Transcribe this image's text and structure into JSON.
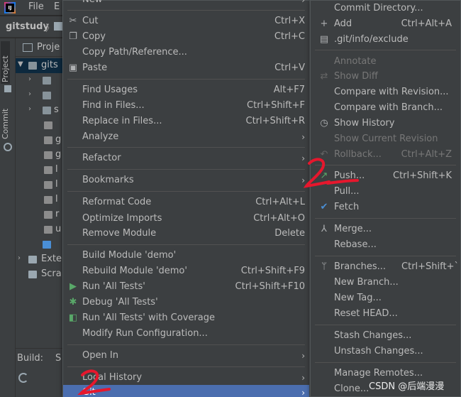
{
  "menubar": {
    "logo_text": "IJ",
    "items": [
      "File",
      "E"
    ]
  },
  "navbar": {
    "project": "gitstudy"
  },
  "left_strip": {
    "project_tab": "Project",
    "commit_tab": "Commit"
  },
  "project_panel": {
    "title": "Proje",
    "rows": [
      "gits",
      "",
      "",
      "s",
      "",
      "g",
      "g",
      "l",
      "l",
      "l",
      "r",
      "u",
      "",
      "Exte",
      "Scra"
    ]
  },
  "build_panel": {
    "label": "Build:",
    "tab": "S"
  },
  "left_menu": {
    "new": "New",
    "cut": "Cut",
    "cut_sc": "Ctrl+X",
    "copy": "Copy",
    "copy_sc": "Ctrl+C",
    "copy_path": "Copy Path/Reference...",
    "paste": "Paste",
    "paste_sc": "Ctrl+V",
    "find_usages": "Find Usages",
    "find_usages_sc": "Alt+F7",
    "find_in_files": "Find in Files...",
    "find_in_files_sc": "Ctrl+Shift+F",
    "replace_in_files": "Replace in Files...",
    "replace_in_files_sc": "Ctrl+Shift+R",
    "analyze": "Analyze",
    "refactor": "Refactor",
    "bookmarks": "Bookmarks",
    "reformat": "Reformat Code",
    "reformat_sc": "Ctrl+Alt+L",
    "optimize": "Optimize Imports",
    "optimize_sc": "Ctrl+Alt+O",
    "remove_module": "Remove Module",
    "remove_module_sc": "Delete",
    "build_module": "Build Module 'demo'",
    "rebuild_module": "Rebuild Module 'demo'",
    "rebuild_module_sc": "Ctrl+Shift+F9",
    "run_tests": "Run 'All Tests'",
    "run_tests_sc": "Ctrl+Shift+F10",
    "debug_tests": "Debug 'All Tests'",
    "run_coverage": "Run 'All Tests' with Coverage",
    "modify_run": "Modify Run Configuration...",
    "open_in": "Open In",
    "local_history": "Local History",
    "git": "Git"
  },
  "right_menu": {
    "commit_dir": "Commit Directory...",
    "add": "Add",
    "add_sc": "Ctrl+Alt+A",
    "exclude": ".git/info/exclude",
    "annotate": "Annotate",
    "show_diff": "Show Diff",
    "compare_revision": "Compare with Revision...",
    "compare_branch": "Compare with Branch...",
    "show_history": "Show History",
    "show_current_revision": "Show Current Revision",
    "rollback": "Rollback...",
    "rollback_sc": "Ctrl+Alt+Z",
    "push": "Push...",
    "push_sc": "Ctrl+Shift+K",
    "pull": "Pull...",
    "fetch": "Fetch",
    "merge": "Merge...",
    "rebase": "Rebase...",
    "branches": "Branches...",
    "branches_sc": "Ctrl+Shift+`",
    "new_branch": "New Branch...",
    "new_tag": "New Tag...",
    "reset_head": "Reset HEAD...",
    "stash": "Stash Changes...",
    "unstash": "Unstash Changes...",
    "manage_remotes": "Manage Remotes...",
    "clone": "Clone..."
  },
  "watermark": "CSDN @后端漫漫",
  "colors": {
    "selection": "#4b6eaf",
    "annotation_red": "#e6172d",
    "menu_bg": "#3c3f41"
  }
}
